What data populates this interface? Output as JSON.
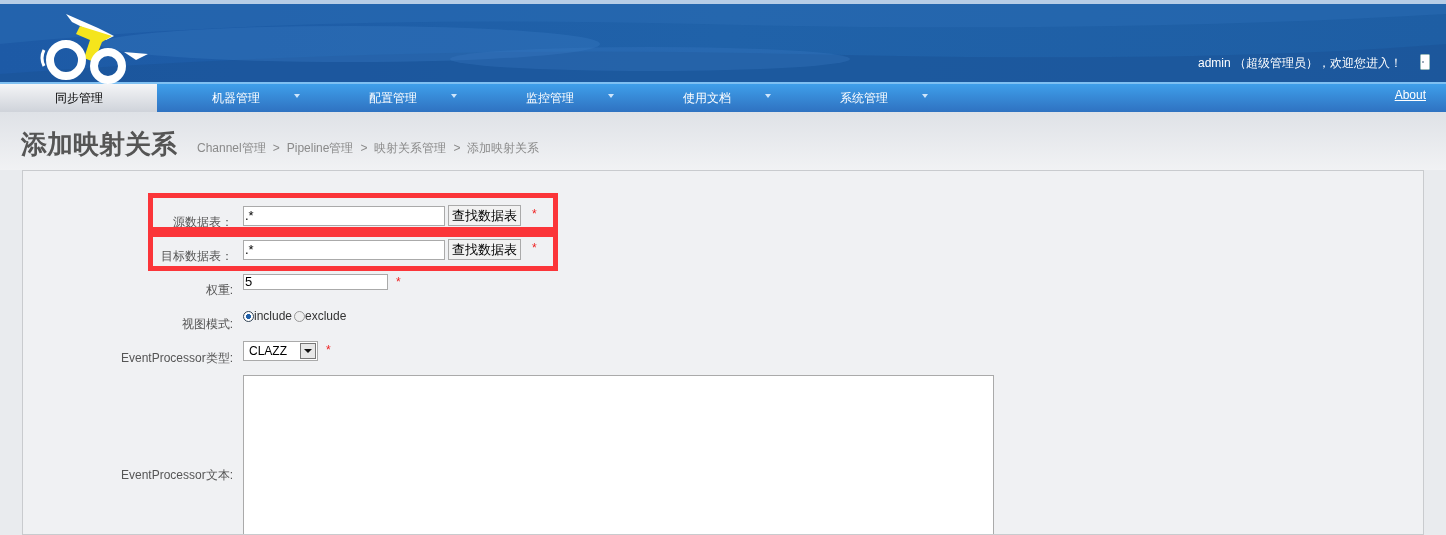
{
  "header": {
    "greeting": "admin （超级管理员），欢迎您进入！"
  },
  "nav": {
    "items": [
      {
        "label": "同步管理",
        "selected": true,
        "has_menu": false
      },
      {
        "label": "机器管理",
        "selected": false,
        "has_menu": true
      },
      {
        "label": "配置管理",
        "selected": false,
        "has_menu": true
      },
      {
        "label": "监控管理",
        "selected": false,
        "has_menu": true
      },
      {
        "label": "使用文档",
        "selected": false,
        "has_menu": true
      },
      {
        "label": "系统管理",
        "selected": false,
        "has_menu": true
      }
    ],
    "about": "About"
  },
  "page_title": "添加映射关系",
  "breadcrumb": [
    "Channel管理",
    "Pipeline管理",
    "映射关系管理",
    "添加映射关系"
  ],
  "breadcrumb_separator": ">",
  "form": [
    {
      "kind": "lookup",
      "label": "源数据表：",
      "value": ".*",
      "button": "查找数据表",
      "required": "*",
      "highlighted": true
    },
    {
      "kind": "lookup",
      "label": "目标数据表：",
      "value": ".*",
      "button": "查找数据表",
      "required": "*",
      "highlighted": true
    },
    {
      "kind": "text",
      "label": "权重:",
      "value": "5",
      "required": "*"
    },
    {
      "kind": "radio",
      "label": "视图模式:",
      "options": [
        {
          "label": "include",
          "selected": true
        },
        {
          "label": "exclude",
          "selected": false
        }
      ]
    },
    {
      "kind": "select",
      "label": "EventProcessor类型:",
      "value": "CLAZZ",
      "required": "*"
    },
    {
      "kind": "textarea",
      "label": "EventProcessor文本:"
    }
  ]
}
